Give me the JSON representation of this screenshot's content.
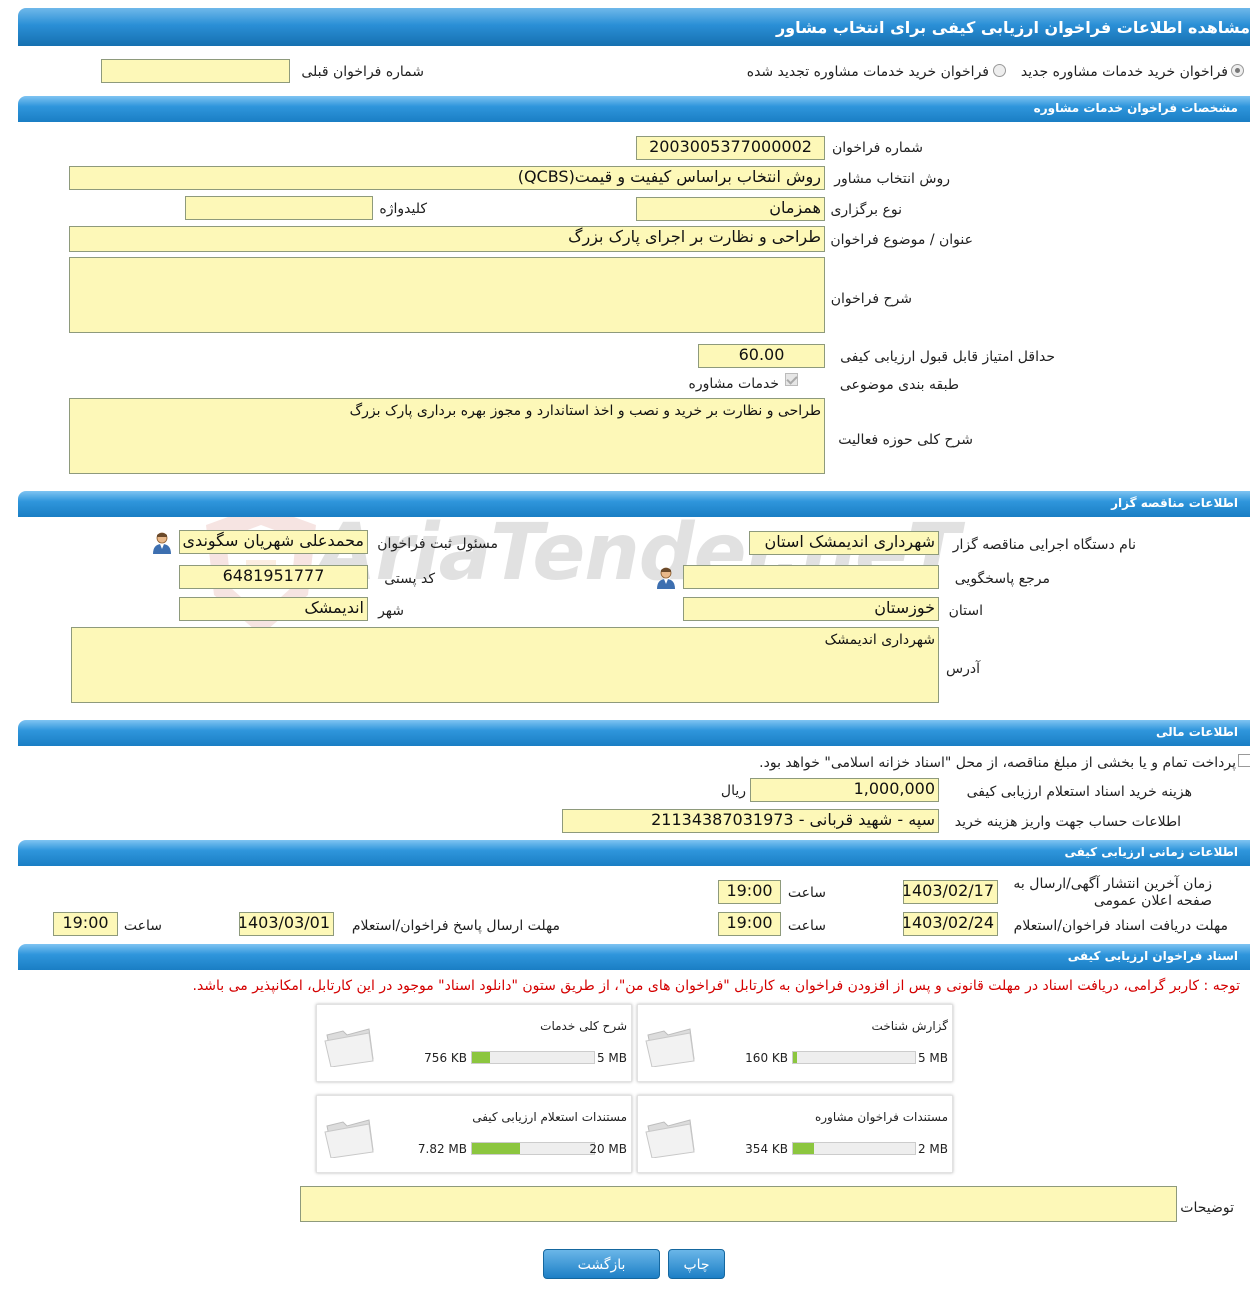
{
  "page_title": "مشاهده اطلاعات فراخوان ارزیابی کیفی برای انتخاب مشاور",
  "top": {
    "radio_new": "فراخوان خرید خدمات مشاوره جدید",
    "radio_renewed": "فراخوان خرید خدمات مشاوره تجدید شده",
    "prev_call_label": "شماره فراخوان قبلی",
    "prev_call_value": ""
  },
  "sections": {
    "consulting": "مشخصات فراخوان خدمات مشاوره",
    "tenderer": "اطلاعات مناقصه گزار",
    "financial": "اطلاعات مالی",
    "timing": "اطلاعات زمانی ارزیابی کیفی",
    "documents": "اسناد فراخوان ارزیابی کیفی"
  },
  "consulting": {
    "call_number_label": "شماره فراخوان",
    "call_number": "2003005377000002",
    "selection_method_label": "روش انتخاب مشاور",
    "selection_method": "روش انتخاب براساس کیفیت و قیمت(QCBS)",
    "holding_type_label": "نوع برگزاری",
    "holding_type": "همزمان",
    "keyword_label": "کلیدواژه",
    "keyword": "",
    "subject_label": "عنوان / موضوع فراخوان",
    "subject": "طراحی و نظارت بر اجرای پارک بزرگ",
    "description_label": "شرح فراخوان",
    "description": "",
    "min_score_label": "حداقل امتیاز قابل قبول ارزیابی کیفی",
    "min_score": "60.00",
    "category_label": "طبقه بندی موضوعی",
    "category_item": "خدمات مشاوره",
    "scope_label": "شرح کلی حوزه فعالیت",
    "scope": "طراحی و نظارت بر خرید و نصب و اخذ استاندارد و مجوز بهره برداری  پارک بزرگ"
  },
  "tenderer": {
    "org_label": "نام دستگاه اجرایی مناقصه گزار",
    "org": "شهرداری اندیمشک استان",
    "registrar_label": "مسئول ثبت فراخوان",
    "registrar": "محمدعلی شهریان سگوندی",
    "responder_label": "مرجع پاسخگویی",
    "responder": "",
    "postal_label": "کد پستی",
    "postal": "6481951777",
    "province_label": "استان",
    "province": "خوزستان",
    "city_label": "شهر",
    "city": "اندیمشک",
    "address_label": "آدرس",
    "address": "شهرداری اندیمشک"
  },
  "financial": {
    "islamic_treasury_text": "پرداخت تمام و یا بخشی از مبلغ مناقصه، از محل \"اسناد خزانه اسلامی\" خواهد بود.",
    "doc_fee_label": "هزینه خرید اسناد استعلام ارزیابی کیفی",
    "doc_fee": "1,000,000",
    "currency": "ریال",
    "account_label": "اطلاعات حساب جهت واریز هزینه خرید",
    "account": "سپه - شهید قربانی - 21134387031973"
  },
  "timing": {
    "publish_label": "زمان آخرین انتشار آگهی/ارسال به صفحه اعلان عمومی",
    "publish_date": "1403/02/17",
    "publish_time_label": "ساعت",
    "publish_time": "19:00",
    "receive_label": "مهلت دریافت اسناد فراخوان/استعلام",
    "receive_date": "1403/02/24",
    "receive_time_label": "ساعت",
    "receive_time": "19:00",
    "response_label": "مهلت ارسال پاسخ فراخوان/استعلام",
    "response_date": "1403/03/01",
    "response_time_label": "ساعت",
    "response_time": "19:00"
  },
  "documents": {
    "note": "توجه : کاربر گرامی، دریافت اسناد در مهلت قانونی و پس از افزودن فراخوان به کارتابل \"فراخوان های من\"، از طریق ستون \"دانلود اسناد\" موجود در این کارتابل، امکانپذیر می باشد.",
    "files": [
      {
        "title": "گزارش شناخت",
        "max": "5 MB",
        "used": "160 KB",
        "fraction": 0.03
      },
      {
        "title": "شرح کلی خدمات",
        "max": "5 MB",
        "used": "756 KB",
        "fraction": 0.15
      },
      {
        "title": "مستندات فراخوان مشاوره",
        "max": "2 MB",
        "used": "354 KB",
        "fraction": 0.17
      },
      {
        "title": "مستندات استعلام ارزیابی کیفی",
        "max": "20 MB",
        "used": "7.82 MB",
        "fraction": 0.39
      }
    ],
    "comments_label": "توضیحات",
    "comments": ""
  },
  "buttons": {
    "print": "چاپ",
    "back": "بازگشت"
  },
  "watermark": "AriaTender.neT"
}
